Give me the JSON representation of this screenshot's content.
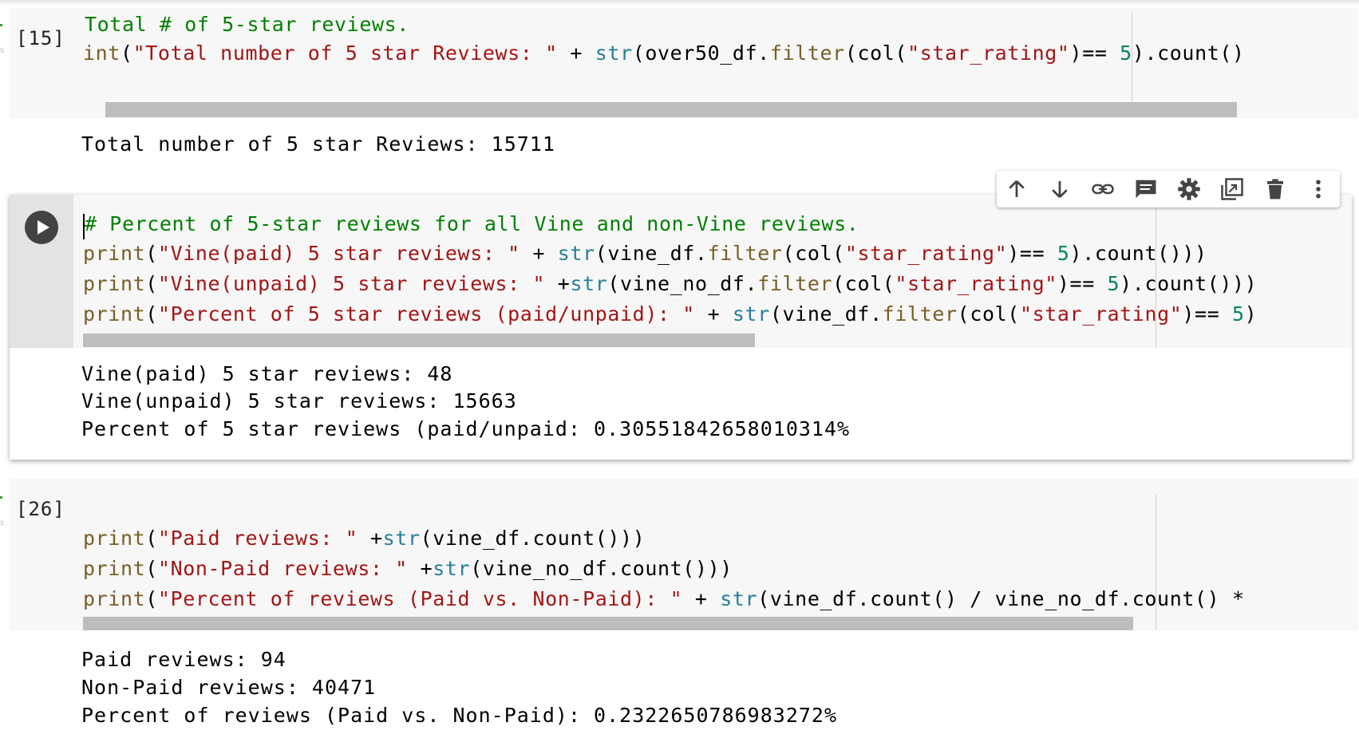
{
  "cell15": {
    "exec_label": "[15]",
    "code_lines": [
      [
        {
          "t": "Total # of 5-star reviews.",
          "c": "cm"
        }
      ],
      [
        {
          "t": "int",
          "c": "kw"
        },
        {
          "t": "(",
          "c": ""
        },
        {
          "t": "\"Total number of 5 star Reviews: \"",
          "c": "str"
        },
        {
          "t": " + ",
          "c": ""
        },
        {
          "t": "str",
          "c": "bi"
        },
        {
          "t": "(over50_df.",
          "c": ""
        },
        {
          "t": "filter",
          "c": "kw"
        },
        {
          "t": "(col(",
          "c": ""
        },
        {
          "t": "\"star_rating\"",
          "c": "str"
        },
        {
          "t": ")== ",
          "c": ""
        },
        {
          "t": "5",
          "c": "num"
        },
        {
          "t": ").count()",
          "c": ""
        }
      ]
    ],
    "output": [
      "Total number of 5 star Reviews: 15711"
    ]
  },
  "cell_active": {
    "code_lines": [
      [
        {
          "t": "# Percent of 5-star reviews for all Vine and non-Vine reviews.",
          "c": "cm"
        }
      ],
      [
        {
          "t": "print",
          "c": "kw"
        },
        {
          "t": "(",
          "c": ""
        },
        {
          "t": "\"Vine(paid) 5 star reviews: \"",
          "c": "str"
        },
        {
          "t": " + ",
          "c": ""
        },
        {
          "t": "str",
          "c": "bi"
        },
        {
          "t": "(vine_df.",
          "c": ""
        },
        {
          "t": "filter",
          "c": "kw"
        },
        {
          "t": "(col(",
          "c": ""
        },
        {
          "t": "\"star_rating\"",
          "c": "str"
        },
        {
          "t": ")== ",
          "c": ""
        },
        {
          "t": "5",
          "c": "num"
        },
        {
          "t": ").count()))",
          "c": ""
        }
      ],
      [
        {
          "t": "print",
          "c": "kw"
        },
        {
          "t": "(",
          "c": ""
        },
        {
          "t": "\"Vine(unpaid) 5 star reviews: \"",
          "c": "str"
        },
        {
          "t": " +",
          "c": ""
        },
        {
          "t": "str",
          "c": "bi"
        },
        {
          "t": "(vine_no_df.",
          "c": ""
        },
        {
          "t": "filter",
          "c": "kw"
        },
        {
          "t": "(col(",
          "c": ""
        },
        {
          "t": "\"star_rating\"",
          "c": "str"
        },
        {
          "t": ")== ",
          "c": ""
        },
        {
          "t": "5",
          "c": "num"
        },
        {
          "t": ").count()))",
          "c": ""
        }
      ],
      [
        {
          "t": "print",
          "c": "kw"
        },
        {
          "t": "(",
          "c": ""
        },
        {
          "t": "\"Percent of 5 star reviews (paid/unpaid): \"",
          "c": "str"
        },
        {
          "t": " + ",
          "c": ""
        },
        {
          "t": "str",
          "c": "bi"
        },
        {
          "t": "(vine_df.",
          "c": ""
        },
        {
          "t": "filter",
          "c": "kw"
        },
        {
          "t": "(col(",
          "c": ""
        },
        {
          "t": "\"star_rating\"",
          "c": "str"
        },
        {
          "t": ")== ",
          "c": ""
        },
        {
          "t": "5",
          "c": "num"
        },
        {
          "t": ")",
          "c": ""
        }
      ]
    ],
    "output": [
      "Vine(paid) 5 star reviews: 48",
      "Vine(unpaid) 5 star reviews: 15663",
      "Percent of 5 star reviews (paid/unpaid: 0.30551842658010314%"
    ],
    "toolbar_icons": [
      "arrow-up-icon",
      "arrow-down-icon",
      "link-icon",
      "comment-icon",
      "gear-icon",
      "mirror-cell-icon",
      "trash-icon",
      "more-vert-icon"
    ]
  },
  "cell26": {
    "exec_label": "[26]",
    "code_lines": [
      [
        {
          "t": "print",
          "c": "kw"
        },
        {
          "t": "(",
          "c": ""
        },
        {
          "t": "\"Paid reviews: \"",
          "c": "str"
        },
        {
          "t": " +",
          "c": ""
        },
        {
          "t": "str",
          "c": "bi"
        },
        {
          "t": "(vine_df.count()))",
          "c": ""
        }
      ],
      [
        {
          "t": "print",
          "c": "kw"
        },
        {
          "t": "(",
          "c": ""
        },
        {
          "t": "\"Non-Paid reviews: \"",
          "c": "str"
        },
        {
          "t": " +",
          "c": ""
        },
        {
          "t": "str",
          "c": "bi"
        },
        {
          "t": "(vine_no_df.count()))",
          "c": ""
        }
      ],
      [
        {
          "t": "print",
          "c": "kw"
        },
        {
          "t": "(",
          "c": ""
        },
        {
          "t": "\"Percent of reviews (Paid vs. Non-Paid): \"",
          "c": "str"
        },
        {
          "t": " + ",
          "c": ""
        },
        {
          "t": "str",
          "c": "bi"
        },
        {
          "t": "(vine_df.count() / vine_no_df.count() *",
          "c": ""
        }
      ]
    ],
    "output": [
      "Paid reviews: 94",
      "Non-Paid reviews: 40471",
      "Percent of reviews (Paid vs. Non-Paid): 0.2322650786983272%"
    ]
  },
  "colors": {
    "keyword": "#795e26",
    "string": "#a31515",
    "builtin": "#267f99",
    "number": "#098658",
    "comment": "#008000"
  }
}
